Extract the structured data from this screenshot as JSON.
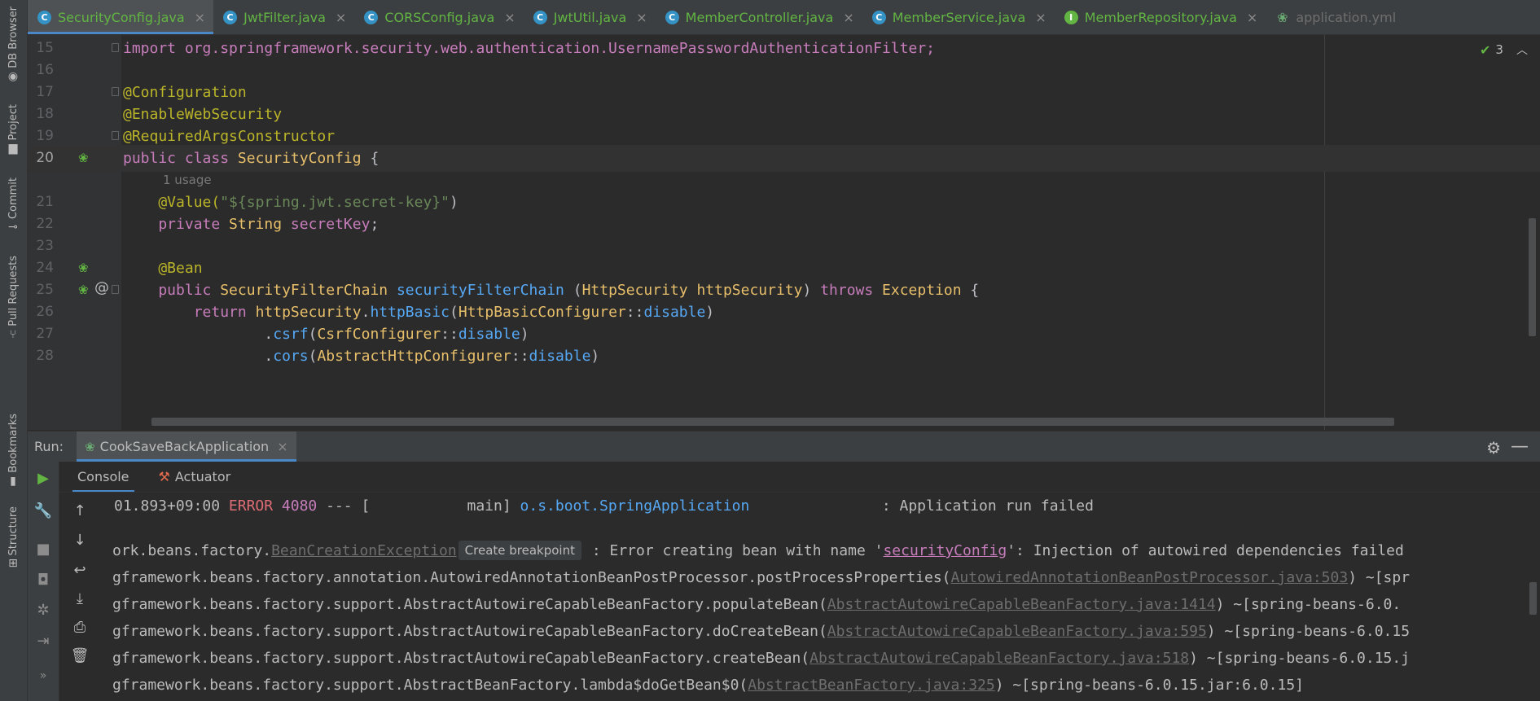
{
  "left_strip": {
    "tools": [
      {
        "label": "DB Browser",
        "icon": "db-icon"
      },
      {
        "label": "Project",
        "icon": "folder-icon"
      },
      {
        "label": "Commit",
        "icon": "commit-icon"
      },
      {
        "label": "Pull Requests",
        "icon": "pull-request-icon"
      },
      {
        "label": "Bookmarks",
        "icon": "bookmark-icon"
      },
      {
        "label": "Structure",
        "icon": "structure-icon"
      }
    ]
  },
  "tabs": [
    {
      "label": "SecurityConfig.java",
      "icon": "C",
      "active": true
    },
    {
      "label": "JwtFilter.java",
      "icon": "C"
    },
    {
      "label": "CORSConfig.java",
      "icon": "C"
    },
    {
      "label": "JwtUtil.java",
      "icon": "C"
    },
    {
      "label": "MemberController.java",
      "icon": "C"
    },
    {
      "label": "MemberService.java",
      "icon": "C"
    },
    {
      "label": "MemberRepository.java",
      "icon": "I"
    },
    {
      "label": "application.yml",
      "icon": "yml"
    }
  ],
  "close_glyph": "×",
  "inspection": {
    "count": "3"
  },
  "editor": {
    "lines": [
      {
        "num": "15",
        "text": "import org.springframework.security.web.authentication.UsernamePasswordAuthenticationFilter;"
      },
      {
        "num": "16",
        "text": ""
      },
      {
        "num": "17",
        "text": "@Configuration"
      },
      {
        "num": "18",
        "text": "@EnableWebSecurity"
      },
      {
        "num": "19",
        "text": "@RequiredArgsConstructor"
      },
      {
        "num": "20",
        "a": "public class ",
        "b": "SecurityConfig",
        "c": " {"
      },
      {
        "num": "21",
        "a": "    @Value(",
        "b": "\"${spring.jwt.secret-key}\"",
        "c": ")"
      },
      {
        "num": "22",
        "a": "    private ",
        "b": "String ",
        "c": "secretKey",
        "d": ";"
      },
      {
        "num": "23",
        "text": ""
      },
      {
        "num": "24",
        "text": "    @Bean"
      },
      {
        "num": "25",
        "a": "    public ",
        "b": "SecurityFilterChain ",
        "c": "securityFilterChain ",
        "d": "(",
        "e": "HttpSecurity ",
        "f": "httpSecurity",
        "g": ") ",
        "h": "throws ",
        "i": "Exception",
        "j": " {"
      },
      {
        "num": "26",
        "a": "        return ",
        "b": "httpSecurity",
        "c": ".",
        "d": "httpBasic",
        "e": "(",
        "f": "HttpBasicConfigurer",
        "g": "::",
        "h": "disable",
        "i": ")"
      },
      {
        "num": "27",
        "a": "                .",
        "b": "csrf",
        "c": "(",
        "d": "CsrfConfigurer",
        "e": "::",
        "f": "disable",
        "g": ")"
      },
      {
        "num": "28",
        "a": "                .",
        "b": "cors",
        "c": "(",
        "d": "AbstractHttpConfigurer",
        "e": "::",
        "f": "disable",
        "g": ")"
      }
    ],
    "usage_hint": "1 usage"
  },
  "run_panel": {
    "label": "Run:",
    "config_name": "CookSaveBackApplication",
    "sub_tabs": [
      "Console",
      "Actuator"
    ]
  },
  "console": {
    "line1": {
      "a": "01.893+09:00 ",
      "level": "ERROR",
      "pid": " 4080",
      "b": " --- [           main] ",
      "logger": "o.s.boot.SpringApplication",
      "c": "               : Application run failed"
    },
    "line2": {
      "a": "ork.beans.factory.",
      "link": "BeanCreationException",
      "bp": "Create breakpoint",
      "b": " : Error creating bean with name '",
      "bean": "securityConfig",
      "c": "': Injection of autowired dependencies failed"
    },
    "line3": {
      "a": "gframework.beans.factory.annotation.AutowiredAnnotationBeanPostProcessor.postProcessProperties(",
      "link": "AutowiredAnnotationBeanPostProcessor.java:503",
      "b": ") ~[spr"
    },
    "line4": {
      "a": "gframework.beans.factory.support.AbstractAutowireCapableBeanFactory.populateBean(",
      "link": "AbstractAutowireCapableBeanFactory.java:1414",
      "b": ") ~[spring-beans-6.0."
    },
    "line5": {
      "a": "gframework.beans.factory.support.AbstractAutowireCapableBeanFactory.doCreateBean(",
      "link": "AbstractAutowireCapableBeanFactory.java:595",
      "b": ") ~[spring-beans-6.0.15"
    },
    "line6": {
      "a": "gframework.beans.factory.support.AbstractAutowireCapableBeanFactory.createBean(",
      "link": "AbstractAutowireCapableBeanFactory.java:518",
      "b": ") ~[spring-beans-6.0.15.j"
    },
    "line7": {
      "a": "gframework.beans.factory.support.AbstractBeanFactory.lambda$doGetBean$0(",
      "link": "AbstractBeanFactory.java:325",
      "b": ") ~[spring-beans-6.0.15.jar:6.0.15]"
    }
  },
  "colors": {
    "editor_bg": "#2b2b2b",
    "panel_bg": "#3c3f41",
    "accent_blue": "#4a88c7",
    "keyword": "#cc7832",
    "annotation": "#bbb529",
    "error": "#e06c75"
  }
}
